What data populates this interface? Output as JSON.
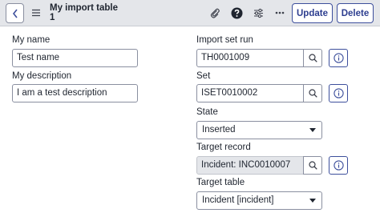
{
  "header": {
    "title_line1": "My import table",
    "title_line2": "1",
    "update_label": "Update",
    "delete_label": "Delete"
  },
  "form": {
    "name": {
      "label": "My name",
      "value": "Test name"
    },
    "description": {
      "label": "My description",
      "value": "I am a test description"
    },
    "import_set_run": {
      "label": "Import set run",
      "value": "TH0001009"
    },
    "set": {
      "label": "Set",
      "value": "ISET0010002"
    },
    "state": {
      "label": "State",
      "value": "Inserted"
    },
    "target_record": {
      "label": "Target record",
      "value": "Incident: INC0010007"
    },
    "target_table": {
      "label": "Target table",
      "value": "Incident [incident]"
    }
  },
  "icons": {
    "back": "chevron-left-icon",
    "menu": "hamburger-menu-icon",
    "attachment": "paperclip-icon",
    "help": "question-circle-icon",
    "settings": "sliders-icon",
    "more": "ellipsis-icon",
    "lookup": "search-icon",
    "info": "info-circle-icon"
  },
  "colors": {
    "header_bg": "#e4e6ea",
    "accent": "#3d4f9c",
    "readonly_bg": "#e4e6ea"
  }
}
